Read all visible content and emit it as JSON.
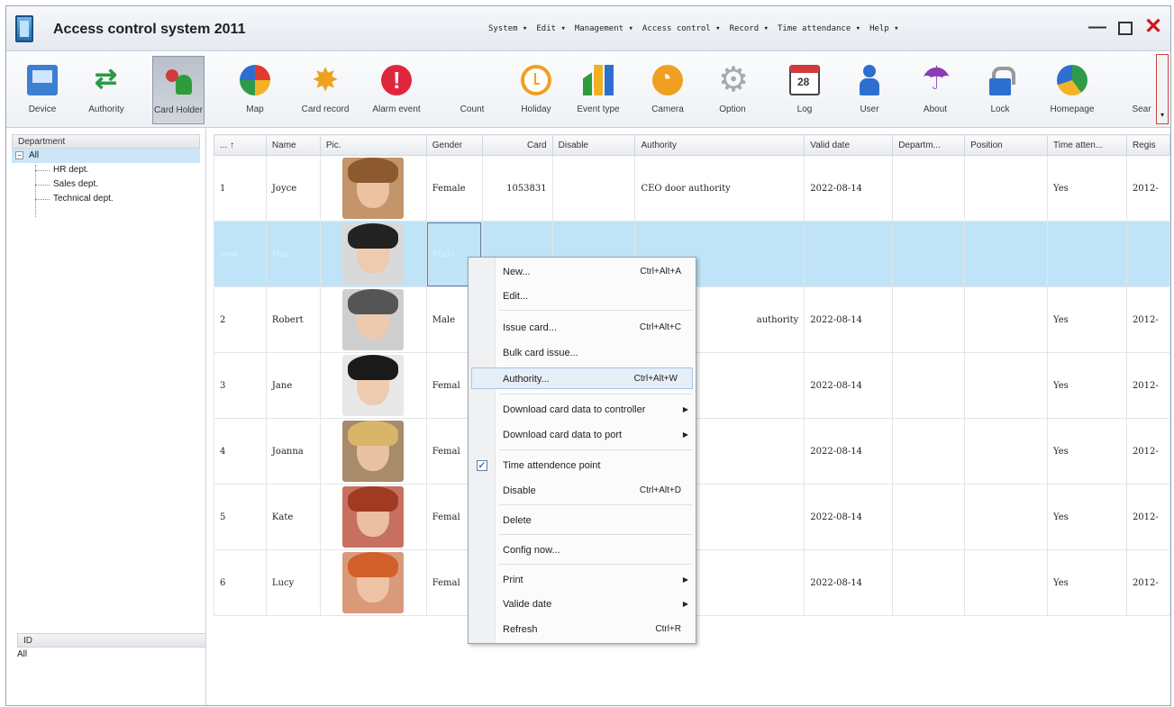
{
  "window": {
    "title": "Access control system 2011",
    "menu": [
      "System ▾",
      "Edit ▾",
      "Management ▾",
      "Access control ▾",
      "Record ▾",
      "Time attendance ▾",
      "Help ▾"
    ]
  },
  "toolbar": {
    "items": [
      {
        "label": "Device",
        "icon": "device-icon"
      },
      {
        "label": "Authority",
        "icon": "authority-icon"
      },
      {
        "label": "Card Holder",
        "icon": "card-holder-icon",
        "active": true
      },
      {
        "label": "Map",
        "icon": "map-icon"
      },
      {
        "label": "Card record",
        "icon": "card-record-icon"
      },
      {
        "label": "Alarm event",
        "icon": "alarm-event-icon"
      },
      {
        "label": "Count",
        "icon": "count-icon"
      },
      {
        "label": "Holiday",
        "icon": "holiday-icon"
      },
      {
        "label": "Event type",
        "icon": "event-type-icon"
      },
      {
        "label": "Camera",
        "icon": "camera-icon"
      },
      {
        "label": "Option",
        "icon": "option-icon"
      },
      {
        "label": "Log",
        "icon": "log-icon"
      },
      {
        "label": "User",
        "icon": "user-icon"
      },
      {
        "label": "About",
        "icon": "about-icon"
      },
      {
        "label": "Lock",
        "icon": "lock-icon"
      },
      {
        "label": "Homepage",
        "icon": "homepage-icon"
      },
      {
        "label": "Sear",
        "icon": "search-icon"
      }
    ]
  },
  "department_panel": {
    "header": "Department",
    "root": "All",
    "children": [
      "HR dept.",
      "Sales dept.",
      "Technical dept."
    ]
  },
  "id_panel": {
    "header": "ID",
    "value": "All"
  },
  "table": {
    "columns": [
      "... ↑",
      "Name",
      "Pic.",
      "Gender",
      "Card",
      "Disable",
      "Authority",
      "Valid date",
      "Departm...",
      "Position",
      "Time atten...",
      "Regis"
    ],
    "rows": [
      {
        "no": "1",
        "name": "Joyce",
        "gender": "Female",
        "card": "1053831",
        "authority": "CEO door authority",
        "valid": "2022-08-14",
        "time": "Yes",
        "regis": "2012-"
      },
      {
        "no": "new",
        "name": "N/a",
        "gender": "Male",
        "card": "",
        "authority": "",
        "valid": "",
        "time": "",
        "regis": "",
        "selected": true
      },
      {
        "no": "2",
        "name": "Robert",
        "gender": "Male",
        "card": "",
        "authority": "authority",
        "valid": "2022-08-14",
        "time": "Yes",
        "regis": "2012-"
      },
      {
        "no": "3",
        "name": "Jane",
        "gender": "Femal",
        "card": "",
        "authority": "",
        "valid": "2022-08-14",
        "time": "Yes",
        "regis": "2012-"
      },
      {
        "no": "4",
        "name": "Joanna",
        "gender": "Femal",
        "card": "",
        "authority": "",
        "valid": "2022-08-14",
        "time": "Yes",
        "regis": "2012-"
      },
      {
        "no": "5",
        "name": "Kate",
        "gender": "Femal",
        "card": "",
        "authority": "",
        "valid": "2022-08-14",
        "time": "Yes",
        "regis": "2012-"
      },
      {
        "no": "6",
        "name": "Lucy",
        "gender": "Femal",
        "card": "",
        "authority": "",
        "valid": "2022-08-14",
        "time": "Yes",
        "regis": "2012-"
      }
    ]
  },
  "context_menu": {
    "items": [
      {
        "label": "New...",
        "shortcut": "Ctrl+Alt+A"
      },
      {
        "label": "Edit...",
        "shortcut": ""
      },
      {
        "label": "Issue card...",
        "shortcut": "Ctrl+Alt+C"
      },
      {
        "label": "Bulk card issue...",
        "shortcut": ""
      },
      {
        "label": "Authority...",
        "shortcut": "Ctrl+Alt+W"
      },
      {
        "label": "Download card data to controller",
        "shortcut": ""
      },
      {
        "label": "Download card data to port",
        "shortcut": ""
      },
      {
        "label": "Time attendence point",
        "shortcut": ""
      },
      {
        "label": "Disable",
        "shortcut": "Ctrl+Alt+D"
      },
      {
        "label": "Delete",
        "shortcut": ""
      },
      {
        "label": "Config now...",
        "shortcut": ""
      },
      {
        "label": "Print",
        "shortcut": ""
      },
      {
        "label": "Valide date",
        "shortcut": ""
      },
      {
        "label": "Refresh",
        "shortcut": "Ctrl+R"
      }
    ]
  }
}
